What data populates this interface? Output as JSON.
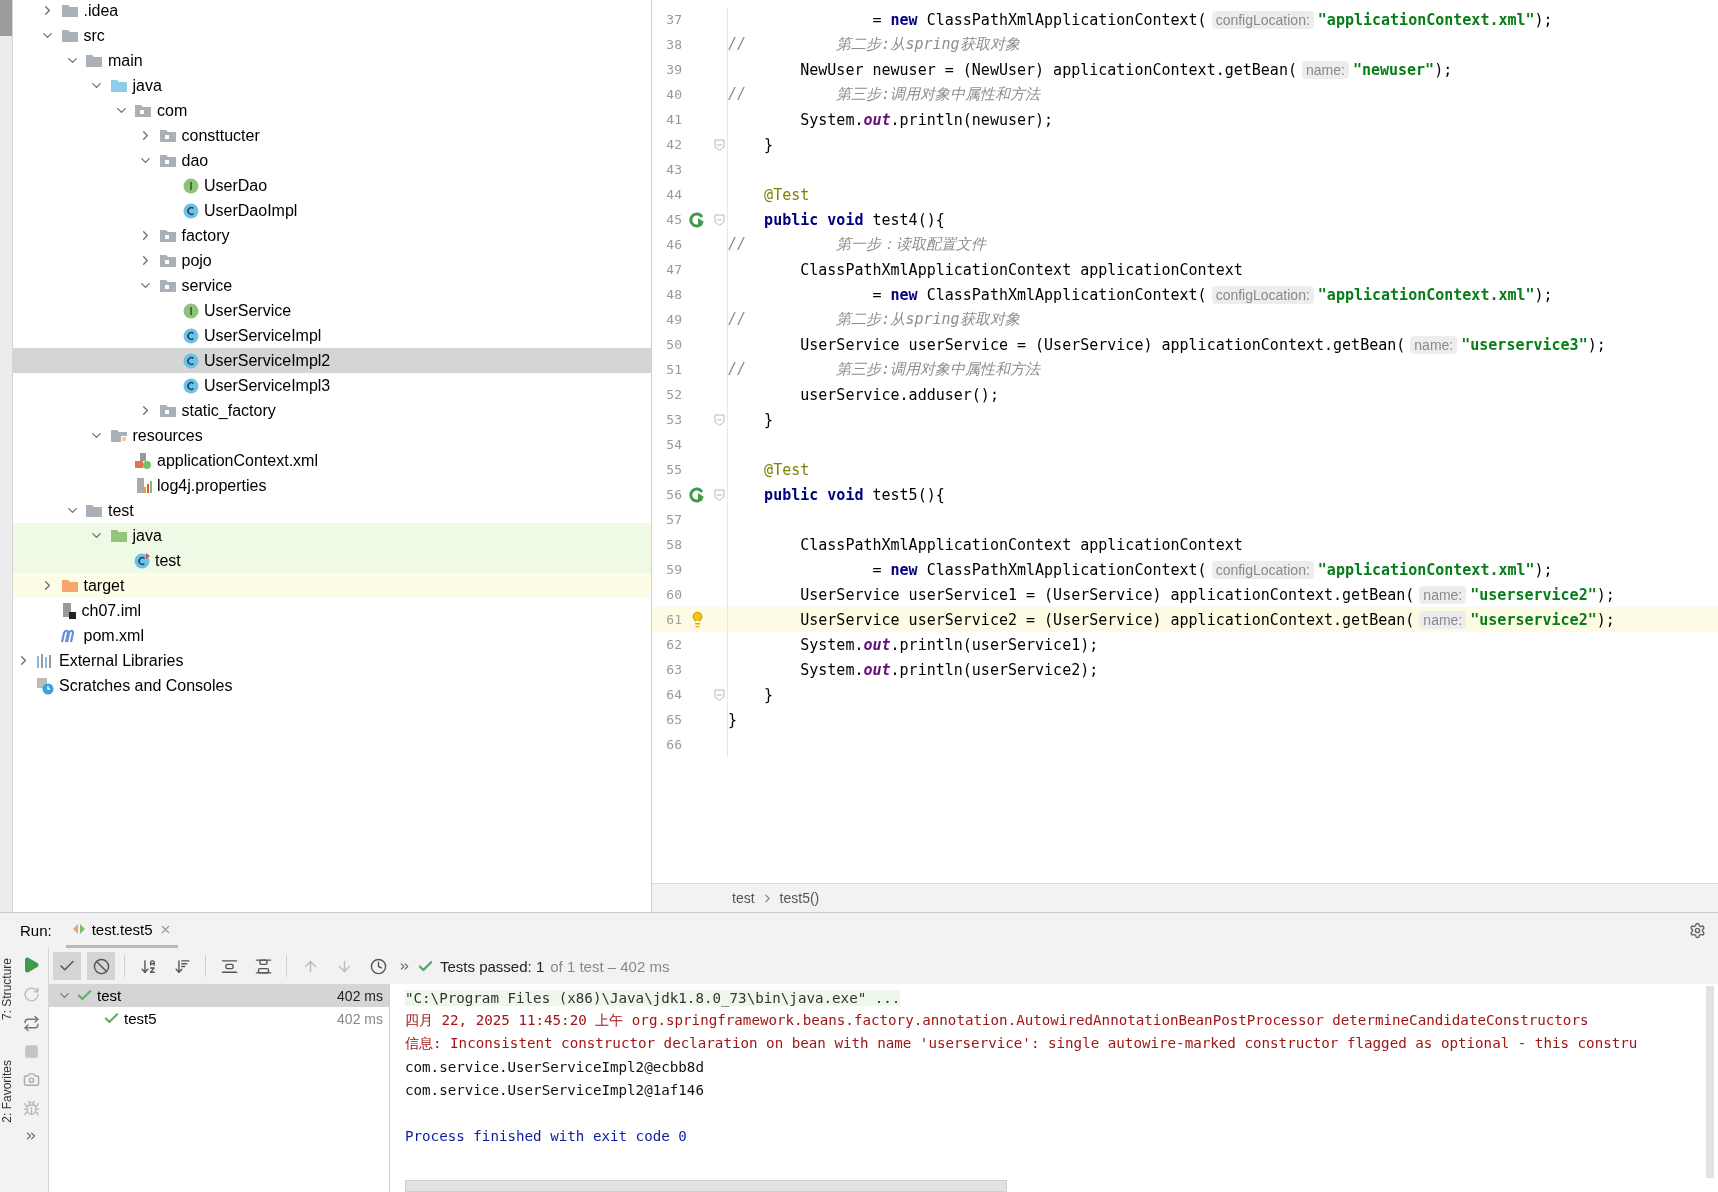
{
  "tree": {
    "project_items": [
      {
        "label": ".idea",
        "kind": "folder",
        "expanded": false,
        "selected": false
      },
      {
        "label": "src",
        "kind": "folder",
        "expanded": true,
        "selected": false,
        "children": [
          {
            "label": "main",
            "kind": "folder",
            "expanded": true,
            "selected": false,
            "children": [
              {
                "label": "java",
                "kind": "source-folder",
                "expanded": true,
                "selected": false,
                "children": [
                  {
                    "label": "com",
                    "kind": "package",
                    "expanded": true,
                    "selected": false,
                    "children": [
                      {
                        "label": "consttucter",
                        "kind": "package",
                        "expanded": false,
                        "selected": false
                      },
                      {
                        "label": "dao",
                        "kind": "package",
                        "expanded": true,
                        "selected": false,
                        "children": [
                          {
                            "label": "UserDao",
                            "kind": "interface",
                            "selected": false
                          },
                          {
                            "label": "UserDaoImpl",
                            "kind": "class",
                            "selected": false
                          }
                        ]
                      },
                      {
                        "label": "factory",
                        "kind": "package",
                        "expanded": false,
                        "selected": false
                      },
                      {
                        "label": "pojo",
                        "kind": "package",
                        "expanded": false,
                        "selected": false
                      },
                      {
                        "label": "service",
                        "kind": "package",
                        "expanded": true,
                        "selected": false,
                        "children": [
                          {
                            "label": "UserService",
                            "kind": "interface",
                            "selected": false
                          },
                          {
                            "label": "UserServiceImpl",
                            "kind": "class",
                            "selected": false
                          },
                          {
                            "label": "UserServiceImpl2",
                            "kind": "class",
                            "selected": true
                          },
                          {
                            "label": "UserServiceImpl3",
                            "kind": "class",
                            "selected": false
                          }
                        ]
                      },
                      {
                        "label": "static_factory",
                        "kind": "package",
                        "expanded": false,
                        "selected": false
                      }
                    ]
                  }
                ]
              },
              {
                "label": "resources",
                "kind": "resources-folder",
                "expanded": true,
                "selected": false,
                "children": [
                  {
                    "label": "applicationContext.xml",
                    "kind": "xml",
                    "selected": false
                  },
                  {
                    "label": "log4j.properties",
                    "kind": "properties",
                    "selected": false
                  }
                ]
              }
            ]
          },
          {
            "label": "test",
            "kind": "folder",
            "expanded": true,
            "selected": false,
            "children": [
              {
                "label": "java",
                "kind": "test-folder",
                "expanded": true,
                "selected": false,
                "children": [
                  {
                    "label": "test",
                    "kind": "test-class",
                    "selected": false
                  }
                ]
              }
            ]
          }
        ]
      },
      {
        "label": "target",
        "kind": "excluded-folder",
        "expanded": false,
        "selected": false
      },
      {
        "label": "ch07.iml",
        "kind": "module-file",
        "selected": false
      },
      {
        "label": "pom.xml",
        "kind": "maven",
        "selected": false
      }
    ],
    "root_items": [
      {
        "label": "External Libraries",
        "kind": "libraries",
        "expanded": false,
        "selected": false
      },
      {
        "label": "Scratches and Consoles",
        "kind": "scratches",
        "selected": false
      }
    ]
  },
  "editor": {
    "lines": [
      {
        "number": "37",
        "kind": "plain",
        "fold": false,
        "current": false,
        "tokens": [
          {
            "kind": "plain",
            "text": "                = "
          },
          {
            "kind": "keyword",
            "text": "new"
          },
          {
            "kind": "plain",
            "text": " ClassPathXmlApplicationContext("
          },
          {
            "kind": "hint",
            "text": "configLocation:"
          },
          {
            "kind": "string",
            "text": "\"applicationContext.xml\""
          },
          {
            "kind": "plain",
            "text": ");"
          }
        ]
      },
      {
        "number": "38",
        "kind": "plain",
        "fold": false,
        "current": false,
        "tokens": [
          {
            "kind": "comment",
            "text": "//          第二步:从spring获取对象"
          }
        ]
      },
      {
        "number": "39",
        "kind": "plain",
        "fold": false,
        "current": false,
        "tokens": [
          {
            "kind": "plain",
            "text": "        NewUser newuser = (NewUser) applicationContext.getBean("
          },
          {
            "kind": "hint",
            "text": "name:"
          },
          {
            "kind": "string",
            "text": "\"newuser\""
          },
          {
            "kind": "plain",
            "text": ");"
          }
        ]
      },
      {
        "number": "40",
        "kind": "plain",
        "fold": false,
        "current": false,
        "tokens": [
          {
            "kind": "comment",
            "text": "//          第三步:调用对象中属性和方法"
          }
        ]
      },
      {
        "number": "41",
        "kind": "plain",
        "fold": false,
        "current": false,
        "tokens": [
          {
            "kind": "plain",
            "text": "        System."
          },
          {
            "kind": "field",
            "text": "out"
          },
          {
            "kind": "plain",
            "text": ".println(newuser);"
          }
        ]
      },
      {
        "number": "42",
        "kind": "plain",
        "fold": true,
        "current": false,
        "tokens": [
          {
            "kind": "plain",
            "text": "    }"
          }
        ]
      },
      {
        "number": "43",
        "kind": "plain",
        "fold": false,
        "current": false
      },
      {
        "number": "44",
        "kind": "plain",
        "fold": false,
        "current": false,
        "tokens": [
          {
            "kind": "annotation",
            "text": "    @Test"
          }
        ]
      },
      {
        "number": "45",
        "kind": "run",
        "fold": true,
        "current": false,
        "tokens": [
          {
            "kind": "keyword",
            "text": "    public"
          },
          {
            "kind": "keyword",
            "text": " void"
          },
          {
            "kind": "plain",
            "text": " test4(){"
          }
        ]
      },
      {
        "number": "46",
        "kind": "plain",
        "fold": false,
        "current": false,
        "tokens": [
          {
            "kind": "comment",
            "text": "//          第一步：读取配置文件"
          }
        ]
      },
      {
        "number": "47",
        "kind": "plain",
        "fold": false,
        "current": false,
        "tokens": [
          {
            "kind": "plain",
            "text": "        ClassPathXmlApplicationContext applicationContext"
          }
        ]
      },
      {
        "number": "48",
        "kind": "plain",
        "fold": false,
        "current": false,
        "tokens": [
          {
            "kind": "plain",
            "text": "                = "
          },
          {
            "kind": "keyword",
            "text": "new"
          },
          {
            "kind": "plain",
            "text": " ClassPathXmlApplicationContext("
          },
          {
            "kind": "hint",
            "text": "configLocation:"
          },
          {
            "kind": "string",
            "text": "\"applicationContext.xml\""
          },
          {
            "kind": "plain",
            "text": ");"
          }
        ]
      },
      {
        "number": "49",
        "kind": "plain",
        "fold": false,
        "current": false,
        "tokens": [
          {
            "kind": "comment",
            "text": "//          第二步:从spring获取对象"
          }
        ]
      },
      {
        "number": "50",
        "kind": "plain",
        "fold": false,
        "current": false,
        "tokens": [
          {
            "kind": "plain",
            "text": "        UserService userService = (UserService) applicationContext.getBean("
          },
          {
            "kind": "hint",
            "text": "name:"
          },
          {
            "kind": "string",
            "text": "\"userservice3\""
          },
          {
            "kind": "plain",
            "text": ");"
          }
        ]
      },
      {
        "number": "51",
        "kind": "plain",
        "fold": false,
        "current": false,
        "tokens": [
          {
            "kind": "comment",
            "text": "//          第三步:调用对象中属性和方法"
          }
        ]
      },
      {
        "number": "52",
        "kind": "plain",
        "fold": false,
        "current": false,
        "tokens": [
          {
            "kind": "plain",
            "text": "        userService.adduser();"
          }
        ]
      },
      {
        "number": "53",
        "kind": "plain",
        "fold": true,
        "current": false,
        "tokens": [
          {
            "kind": "plain",
            "text": "    }"
          }
        ]
      },
      {
        "number": "54",
        "kind": "plain",
        "fold": false,
        "current": false
      },
      {
        "number": "55",
        "kind": "plain",
        "fold": false,
        "current": false,
        "tokens": [
          {
            "kind": "annotation",
            "text": "    @Test"
          }
        ]
      },
      {
        "number": "56",
        "kind": "run",
        "fold": true,
        "current": false,
        "tokens": [
          {
            "kind": "keyword",
            "text": "    public"
          },
          {
            "kind": "keyword",
            "text": " void"
          },
          {
            "kind": "plain",
            "text": " test5(){"
          }
        ]
      },
      {
        "number": "57",
        "kind": "plain",
        "fold": false,
        "current": false
      },
      {
        "number": "58",
        "kind": "plain",
        "fold": false,
        "current": false,
        "tokens": [
          {
            "kind": "plain",
            "text": "        ClassPathXmlApplicationContext applicationContext"
          }
        ]
      },
      {
        "number": "59",
        "kind": "plain",
        "fold": false,
        "current": false,
        "tokens": [
          {
            "kind": "plain",
            "text": "                = "
          },
          {
            "kind": "keyword",
            "text": "new"
          },
          {
            "kind": "plain",
            "text": " ClassPathXmlApplicationContext("
          },
          {
            "kind": "hint",
            "text": "configLocation:"
          },
          {
            "kind": "string",
            "text": "\"applicationContext.xml\""
          },
          {
            "kind": "plain",
            "text": ");"
          }
        ]
      },
      {
        "number": "60",
        "kind": "plain",
        "fold": false,
        "current": false,
        "tokens": [
          {
            "kind": "plain",
            "text": "        UserService userService1 = (UserService) applicationContext.getBean("
          },
          {
            "kind": "hint",
            "text": "name:"
          },
          {
            "kind": "string",
            "text": "\"userservice2\""
          },
          {
            "kind": "plain",
            "text": ");"
          }
        ]
      },
      {
        "number": "61",
        "kind": "intention",
        "fold": false,
        "current": true,
        "tokens": [
          {
            "kind": "plain",
            "text": "        UserService userService2 = (UserService) applicationContext.getBean("
          },
          {
            "kind": "hint",
            "text": "name:"
          },
          {
            "kind": "string",
            "text": "\"userservice2\""
          },
          {
            "kind": "plain",
            "text": ");"
          }
        ]
      },
      {
        "number": "62",
        "kind": "plain",
        "fold": false,
        "current": false,
        "tokens": [
          {
            "kind": "plain",
            "text": "        System."
          },
          {
            "kind": "field",
            "text": "out"
          },
          {
            "kind": "plain",
            "text": ".println(userService1);"
          }
        ]
      },
      {
        "number": "63",
        "kind": "plain",
        "fold": false,
        "current": false,
        "tokens": [
          {
            "kind": "plain",
            "text": "        System."
          },
          {
            "kind": "field",
            "text": "out"
          },
          {
            "kind": "plain",
            "text": ".println(userService2);"
          }
        ]
      },
      {
        "number": "64",
        "kind": "plain",
        "fold": true,
        "current": false,
        "tokens": [
          {
            "kind": "plain",
            "text": "    }"
          }
        ]
      },
      {
        "number": "65",
        "kind": "plain",
        "fold": false,
        "current": false,
        "tokens": [
          {
            "kind": "plain",
            "text": "}"
          }
        ]
      },
      {
        "number": "66",
        "kind": "plain",
        "fold": false,
        "current": false
      }
    ],
    "breadcrumbs": [
      "test",
      "test5()"
    ]
  },
  "side_tabs": [
    "7: Structure",
    "2: Favorites"
  ],
  "run": {
    "label": "Run:",
    "tab": "test.test5",
    "summary": "Tests passed: 1",
    "summary_detail": "of 1 test – 402 ms",
    "tests": [
      {
        "name": "test",
        "time": "402 ms",
        "passed": true,
        "expanded": true,
        "selected": true,
        "children": [
          {
            "name": "test5",
            "time": "402 ms",
            "passed": true,
            "selected": false
          }
        ]
      }
    ],
    "console": [
      {
        "kind": "command",
        "text": "\"C:\\Program Files (x86)\\Java\\jdk1.8.0_73\\bin\\java.exe\" ..."
      },
      {
        "kind": "log",
        "text": "四月 22, 2025 11:45:20 上午 org.springframework.beans.factory.annotation.AutowiredAnnotationBeanPostProcessor determineCandidateConstructors"
      },
      {
        "kind": "log",
        "text": "信息: Inconsistent constructor declaration on bean with name 'userservice': single autowire-marked constructor flagged as optional - this constru"
      },
      {
        "kind": "output",
        "text": "com.service.UserServiceImpl2@ecbb8d"
      },
      {
        "kind": "output",
        "text": "com.service.UserServiceImpl2@1af146"
      },
      {
        "kind": "blank"
      },
      {
        "kind": "exit",
        "text": "Process finished with exit code 0"
      }
    ]
  }
}
